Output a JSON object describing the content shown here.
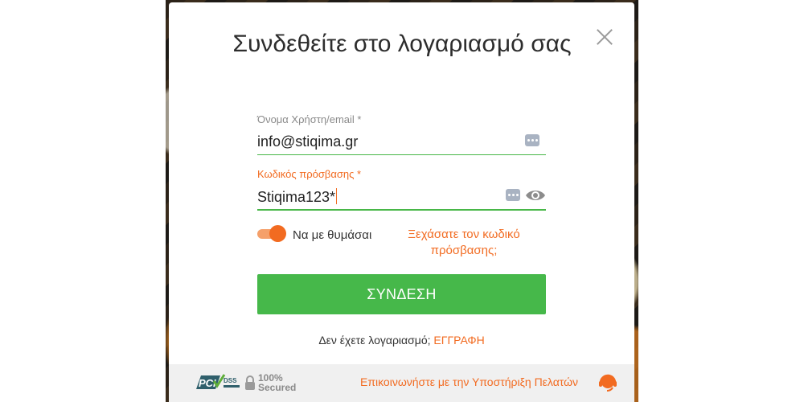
{
  "title": "Συνδεθείτε στο λογαριασμό σας",
  "username": {
    "label": "Όνομα Χρήστη/email *",
    "value": "info@stiqima.gr"
  },
  "password": {
    "label": "Κωδικός πρόσβασης *",
    "value": "Stiqima123*"
  },
  "remember": {
    "label": "Να με θυμάσαι",
    "checked": true
  },
  "forgot_link": "Ξεχάσατε τον κωδικό πρόσβασης;",
  "login_button": "ΣΥΝΔΕΣΗ",
  "register": {
    "prompt": "Δεν έχετε λογαριασμό;",
    "link": "ΕΓΓΡΑΦΗ"
  },
  "footer": {
    "pci_text": "DSS",
    "secured_line1": "100%",
    "secured_line2": "Secured",
    "support_link": "Επικοινωνήστε με την Υποστήριξη Πελατών"
  },
  "colors": {
    "accent": "#f26b21",
    "primary_button": "#46b84a",
    "field_underline": "#48b748"
  },
  "icons": [
    "close-icon",
    "dots-icon",
    "eye-icon",
    "lock-icon",
    "headset-icon",
    "pci-logo"
  ]
}
